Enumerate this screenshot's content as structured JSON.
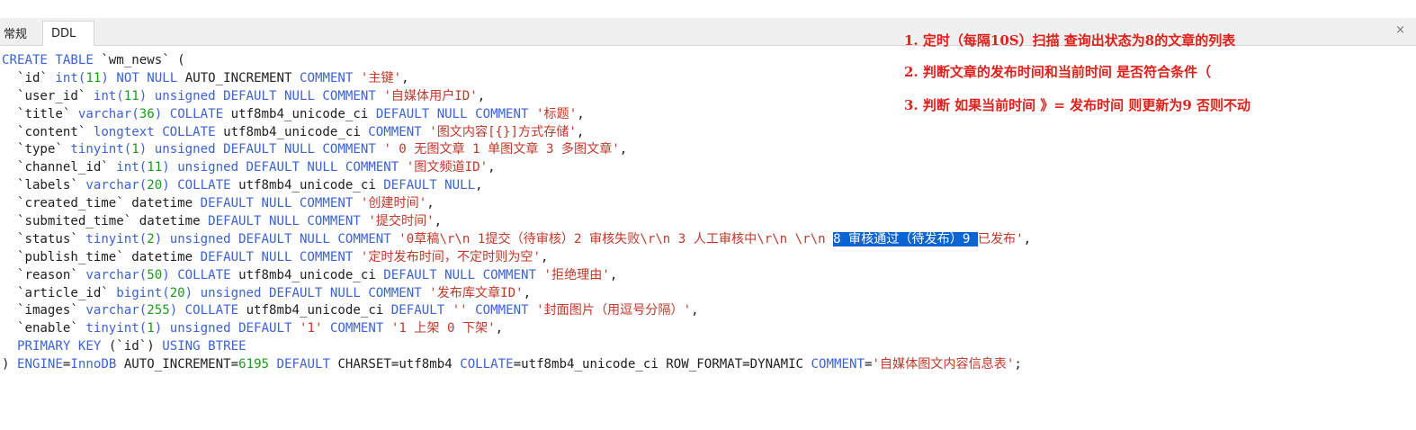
{
  "tabs": [
    {
      "label": "常规",
      "active": false
    },
    {
      "label": "DDL",
      "active": true
    }
  ],
  "close_icon": "×",
  "colors": {
    "keyword": "#3b62d9",
    "number": "#1a9c1a",
    "string": "#c0392b",
    "plain": "#1e1e1e",
    "selection": "#0a64d2",
    "annotation": "#e0201a"
  },
  "annotations": [
    "1. 定时（每隔10S）扫描      查询出状态为8的文章的列表",
    "2.  判断文章的发布时间和当前时间  是否符合条件（",
    "3. 判断  如果当前时间 》=  发布时间  则更新为9  否则不动"
  ],
  "ddl_lines": [
    [
      [
        "k",
        "CREATE TABLE"
      ],
      [
        "p",
        " `wm_news` ("
      ]
    ],
    [
      [
        "p",
        "  `id` "
      ],
      [
        "k",
        "int("
      ],
      [
        "n",
        "11"
      ],
      [
        "k",
        ")"
      ],
      [
        "p",
        " "
      ],
      [
        "k",
        "NOT NULL"
      ],
      [
        "p",
        " AUTO_INCREMENT "
      ],
      [
        "k",
        "COMMENT"
      ],
      [
        "p",
        " "
      ],
      [
        "s",
        "'主键'"
      ],
      [
        "p",
        ","
      ]
    ],
    [
      [
        "p",
        "  `user_id` "
      ],
      [
        "k",
        "int("
      ],
      [
        "n",
        "11"
      ],
      [
        "k",
        ") unsigned DEFAULT NULL COMMENT"
      ],
      [
        "p",
        " "
      ],
      [
        "s",
        "'自媒体用户ID'"
      ],
      [
        "p",
        ","
      ]
    ],
    [
      [
        "p",
        "  `title` "
      ],
      [
        "k",
        "varchar("
      ],
      [
        "n",
        "36"
      ],
      [
        "k",
        ") COLLATE"
      ],
      [
        "p",
        " utf8mb4_unicode_ci "
      ],
      [
        "k",
        "DEFAULT NULL COMMENT"
      ],
      [
        "p",
        " "
      ],
      [
        "s",
        "'标题'"
      ],
      [
        "p",
        ","
      ]
    ],
    [
      [
        "p",
        "  `content` "
      ],
      [
        "k",
        "longtext COLLATE"
      ],
      [
        "p",
        " utf8mb4_unicode_ci "
      ],
      [
        "k",
        "COMMENT"
      ],
      [
        "p",
        " "
      ],
      [
        "s",
        "'图文内容[{}]方式存储'"
      ],
      [
        "p",
        ","
      ]
    ],
    [
      [
        "p",
        "  `type` "
      ],
      [
        "k",
        "tinyint("
      ],
      [
        "n",
        "1"
      ],
      [
        "k",
        ") unsigned DEFAULT NULL COMMENT"
      ],
      [
        "p",
        " "
      ],
      [
        "s",
        "' 0 无图文章 1 单图文章 3 多图文章'"
      ],
      [
        "p",
        ","
      ]
    ],
    [
      [
        "p",
        "  `channel_id` "
      ],
      [
        "k",
        "int("
      ],
      [
        "n",
        "11"
      ],
      [
        "k",
        ") unsigned DEFAULT NULL COMMENT"
      ],
      [
        "p",
        " "
      ],
      [
        "s",
        "'图文频道ID'"
      ],
      [
        "p",
        ","
      ]
    ],
    [
      [
        "p",
        "  `labels` "
      ],
      [
        "k",
        "varchar("
      ],
      [
        "n",
        "20"
      ],
      [
        "k",
        ") COLLATE"
      ],
      [
        "p",
        " utf8mb4_unicode_ci "
      ],
      [
        "k",
        "DEFAULT NULL"
      ],
      [
        "p",
        ","
      ]
    ],
    [
      [
        "p",
        "  `created_time` datetime "
      ],
      [
        "k",
        "DEFAULT NULL COMMENT"
      ],
      [
        "p",
        " "
      ],
      [
        "s",
        "'创建时间'"
      ],
      [
        "p",
        ","
      ]
    ],
    [
      [
        "p",
        "  `submited_time` datetime "
      ],
      [
        "k",
        "DEFAULT NULL COMMENT"
      ],
      [
        "p",
        " "
      ],
      [
        "s",
        "'提交时间'"
      ],
      [
        "p",
        ","
      ]
    ],
    [
      [
        "p",
        "  `status` "
      ],
      [
        "k",
        "tinyint("
      ],
      [
        "n",
        "2"
      ],
      [
        "k",
        ") unsigned DEFAULT NULL COMMENT"
      ],
      [
        "p",
        " "
      ],
      [
        "s",
        "'0草稿\\r\\n 1提交（待审核）2 审核失败\\r\\n 3 人工审核中\\r\\n \\r\\n "
      ],
      [
        "x",
        "8 审核通过（待发布）9 "
      ],
      [
        "s",
        "已发布'"
      ],
      [
        "p",
        ","
      ]
    ],
    [
      [
        "p",
        "  `publish_time` datetime "
      ],
      [
        "k",
        "DEFAULT NULL COMMENT"
      ],
      [
        "p",
        " "
      ],
      [
        "s",
        "'定时发布时间，不定时则为空'"
      ],
      [
        "p",
        ","
      ]
    ],
    [
      [
        "p",
        "  `reason` "
      ],
      [
        "k",
        "varchar("
      ],
      [
        "n",
        "50"
      ],
      [
        "k",
        ") COLLATE"
      ],
      [
        "p",
        " utf8mb4_unicode_ci "
      ],
      [
        "k",
        "DEFAULT NULL COMMENT"
      ],
      [
        "p",
        " "
      ],
      [
        "s",
        "'拒绝理由'"
      ],
      [
        "p",
        ","
      ]
    ],
    [
      [
        "p",
        "  `article_id` "
      ],
      [
        "k",
        "bigint("
      ],
      [
        "n",
        "20"
      ],
      [
        "k",
        ") unsigned DEFAULT NULL COMMENT"
      ],
      [
        "p",
        " "
      ],
      [
        "s",
        "'发布库文章ID'"
      ],
      [
        "p",
        ","
      ]
    ],
    [
      [
        "p",
        "  `images` "
      ],
      [
        "k",
        "varchar("
      ],
      [
        "n",
        "255"
      ],
      [
        "k",
        ") COLLATE"
      ],
      [
        "p",
        " utf8mb4_unicode_ci "
      ],
      [
        "k",
        "DEFAULT"
      ],
      [
        "p",
        " "
      ],
      [
        "s",
        "''"
      ],
      [
        "p",
        " "
      ],
      [
        "k",
        "COMMENT"
      ],
      [
        "p",
        " "
      ],
      [
        "s",
        "'封面图片（用逗号分隔）'"
      ],
      [
        "p",
        ","
      ]
    ],
    [
      [
        "p",
        "  `enable` "
      ],
      [
        "k",
        "tinyint("
      ],
      [
        "n",
        "1"
      ],
      [
        "k",
        ") unsigned DEFAULT"
      ],
      [
        "p",
        " "
      ],
      [
        "s",
        "'1'"
      ],
      [
        "p",
        " "
      ],
      [
        "k",
        "COMMENT"
      ],
      [
        "p",
        " "
      ],
      [
        "s",
        "'1 上架 0 下架'"
      ],
      [
        "p",
        ","
      ]
    ],
    [
      [
        "p",
        "  "
      ],
      [
        "k",
        "PRIMARY KEY"
      ],
      [
        "p",
        " (`id`) "
      ],
      [
        "k",
        "USING BTREE"
      ]
    ],
    [
      [
        "p",
        ") "
      ],
      [
        "k",
        "ENGINE"
      ],
      [
        "p",
        "="
      ],
      [
        "k",
        "InnoDB"
      ],
      [
        "p",
        " AUTO_INCREMENT="
      ],
      [
        "n",
        "6195"
      ],
      [
        "p",
        " "
      ],
      [
        "k",
        "DEFAULT"
      ],
      [
        "p",
        " CHARSET=utf8mb4 "
      ],
      [
        "k",
        "COLLATE"
      ],
      [
        "p",
        "=utf8mb4_unicode_ci ROW_FORMAT=DYNAMIC "
      ],
      [
        "k",
        "COMMENT"
      ],
      [
        "p",
        "="
      ],
      [
        "s",
        "'自媒体图文内容信息表'"
      ],
      [
        "p",
        ";"
      ]
    ]
  ]
}
